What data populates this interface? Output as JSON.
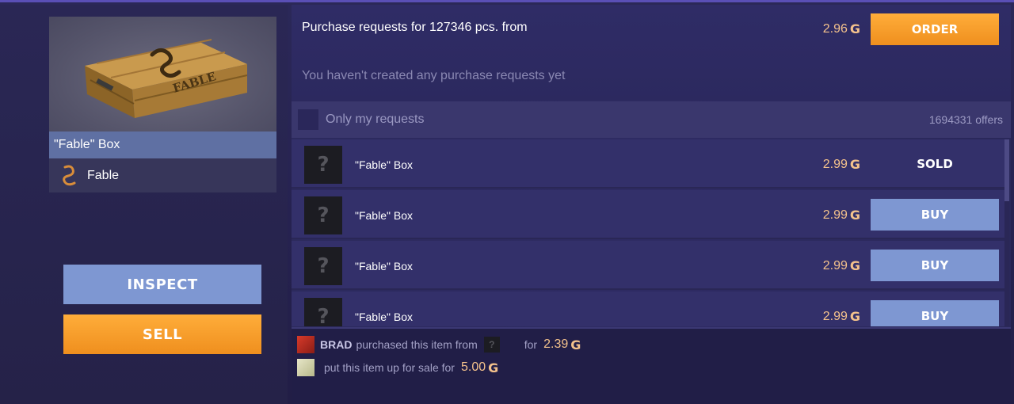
{
  "item": {
    "name": "\"Fable\" Box",
    "collection": "Fable",
    "image_lettering": "FABLE"
  },
  "actions": {
    "inspect_label": "INSPECT",
    "sell_label": "SELL"
  },
  "purchase": {
    "title": "Purchase requests for 127346 pcs. from",
    "price": "2.96",
    "currency_symbol": "G",
    "order_label": "ORDER",
    "empty_text": "You haven't created any purchase requests yet"
  },
  "filter": {
    "only_my_label": "Only my requests",
    "only_my_checked": false,
    "offers_count": "1694331 offers"
  },
  "offers": [
    {
      "name": "\"Fable\" Box",
      "price": "2.99",
      "action": "SOLD",
      "status": "sold",
      "icon": "unknown-item-icon"
    },
    {
      "name": "\"Fable\" Box",
      "price": "2.99",
      "action": "BUY",
      "status": "buy",
      "icon": "unknown-item-icon"
    },
    {
      "name": "\"Fable\" Box",
      "price": "2.99",
      "action": "BUY",
      "status": "buy",
      "icon": "unknown-item-icon"
    },
    {
      "name": "\"Fable\" Box",
      "price": "2.99",
      "action": "BUY",
      "status": "buy",
      "icon": "unknown-item-icon"
    }
  ],
  "history": {
    "line1": {
      "user": "BRAD",
      "text": "purchased this item from",
      "unknown_glyph": "?",
      "for_text": "for",
      "price": "2.39"
    },
    "line2": {
      "text": "put this item up for sale for",
      "price": "5.00"
    }
  },
  "colors": {
    "accent_orange": "#f59b2a",
    "button_blue": "#7e97d2",
    "price_gold": "#f4c28c",
    "panel_dark": "#2c2a5d"
  }
}
